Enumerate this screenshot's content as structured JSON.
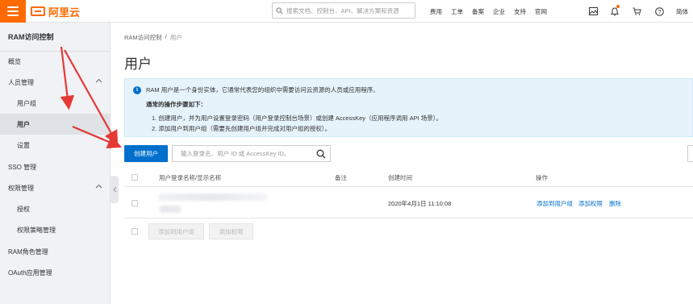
{
  "topbar": {
    "logo_text": "阿里云",
    "search_placeholder": "搜索文档、控制台、API、解决方案和资源",
    "nav": [
      "费用",
      "工单",
      "备案",
      "企业",
      "支持",
      "官网"
    ],
    "lang": "简体"
  },
  "sidebar": {
    "title": "RAM访问控制",
    "items": {
      "overview": "概览",
      "people": "人员管理",
      "usergroup": "用户组",
      "user": "用户",
      "settings": "设置",
      "sso": "SSO 管理",
      "perm": "权限管理",
      "grant": "授权",
      "policy": "权限策略管理",
      "role": "RAM角色管理",
      "oauth": "OAuth应用管理"
    }
  },
  "breadcrumb": {
    "root": "RAM访问控制",
    "sep": "/",
    "current": "用户"
  },
  "page_title": "用户",
  "info": {
    "line1": "RAM 用户是一个身份实体，它通常代表您的组织中需要访问云资源的人员或应用程序。",
    "heading": "通常的操作步骤如下：",
    "step1": "1. 创建用户，并为用户设置登录密码（用户登录控制台场景）或创建 AccessKey（应用程序调用 API 场景）。",
    "step2": "2. 添加用户到用户组（需要先创建用户组并完成对用户组的授权）。"
  },
  "toolbar": {
    "create_label": "创建用户",
    "filter_placeholder": "输入登录名、用户 ID 或 AccessKey ID。"
  },
  "table": {
    "headers": {
      "name": "用户登录名称/显示名称",
      "note": "备注",
      "created": "创建时间",
      "actions": "操作"
    },
    "rows": [
      {
        "created": "2020年4月1日 11:10:08",
        "actions": [
          "添加到用户组",
          "添加权限",
          "删除"
        ]
      }
    ]
  },
  "bulk": {
    "add_group": "添加到用户组",
    "add_perm": "添加权限"
  },
  "colors": {
    "brand": "#ff6a00",
    "primary": "#0070cc",
    "arrow": "#e53935"
  }
}
